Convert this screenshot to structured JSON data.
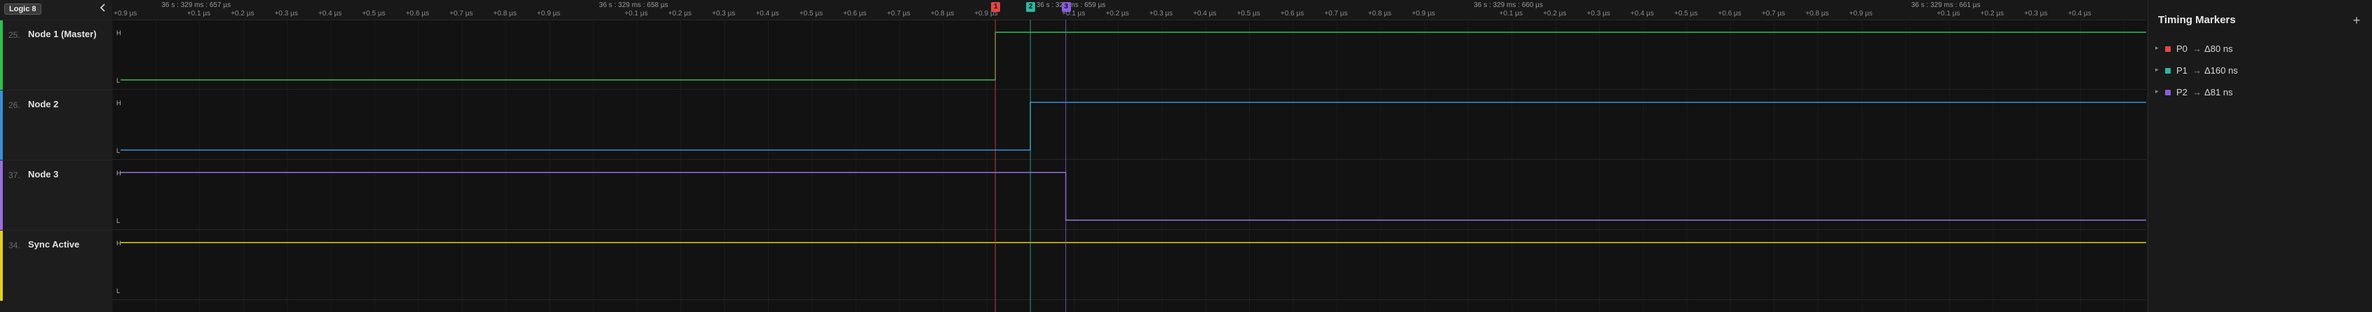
{
  "device": {
    "label": "Logic 8"
  },
  "channels": [
    {
      "num": "25.",
      "name": "Node 1 (Master)",
      "color": "#2fbf4f"
    },
    {
      "num": "26.",
      "name": "Node 2",
      "color": "#3a8fd6"
    },
    {
      "num": "37.",
      "name": "Node 3",
      "color": "#9b6fe0"
    },
    {
      "num": "34.",
      "name": "Sync Active",
      "color": "#e4cf22"
    }
  ],
  "levels": {
    "high": "H",
    "low": "L"
  },
  "ruler": {
    "timestamps": [
      "36 s : 329 ms : 657 µs",
      "36 s : 329 ms : 658 µs",
      "36 s : 329 ms : 659 µs",
      "36 s : 329 ms : 660 µs",
      "36 s : 329 ms : 661 µs"
    ],
    "tick_labels": [
      "+0.1 µs",
      "+0.2 µs",
      "+0.3 µs",
      "+0.4 µs",
      "+0.5 µs",
      "+0.6 µs",
      "+0.7 µs",
      "+0.8 µs",
      "+0.9 µs"
    ]
  },
  "markers_panel": {
    "title": "Timing Markers",
    "add_icon": "plus-icon"
  },
  "markers": [
    {
      "name": "P0",
      "arrow": "→",
      "delta": "Δ80 ns",
      "color": "#e64545",
      "flag": "1"
    },
    {
      "name": "P1",
      "arrow": "→",
      "delta": "Δ160 ns",
      "color": "#2fb5a0",
      "flag": "2"
    },
    {
      "name": "P2",
      "arrow": "→",
      "delta": "Δ81 ns",
      "color": "#8a5ce0",
      "flag": "3"
    }
  ],
  "waveforms": [
    {
      "channel": "Node 1 (Master)",
      "initial": "L",
      "transitions_us": [
        658.919
      ]
    },
    {
      "channel": "Node 2",
      "initial": "L",
      "transitions_us": [
        658.999
      ]
    },
    {
      "channel": "Node 3",
      "initial": "H",
      "transitions_us": [
        659.08
      ]
    },
    {
      "channel": "Sync Active",
      "initial": "H",
      "transitions_us": []
    }
  ],
  "view": {
    "start_us": 656.9,
    "end_us": 661.55
  }
}
